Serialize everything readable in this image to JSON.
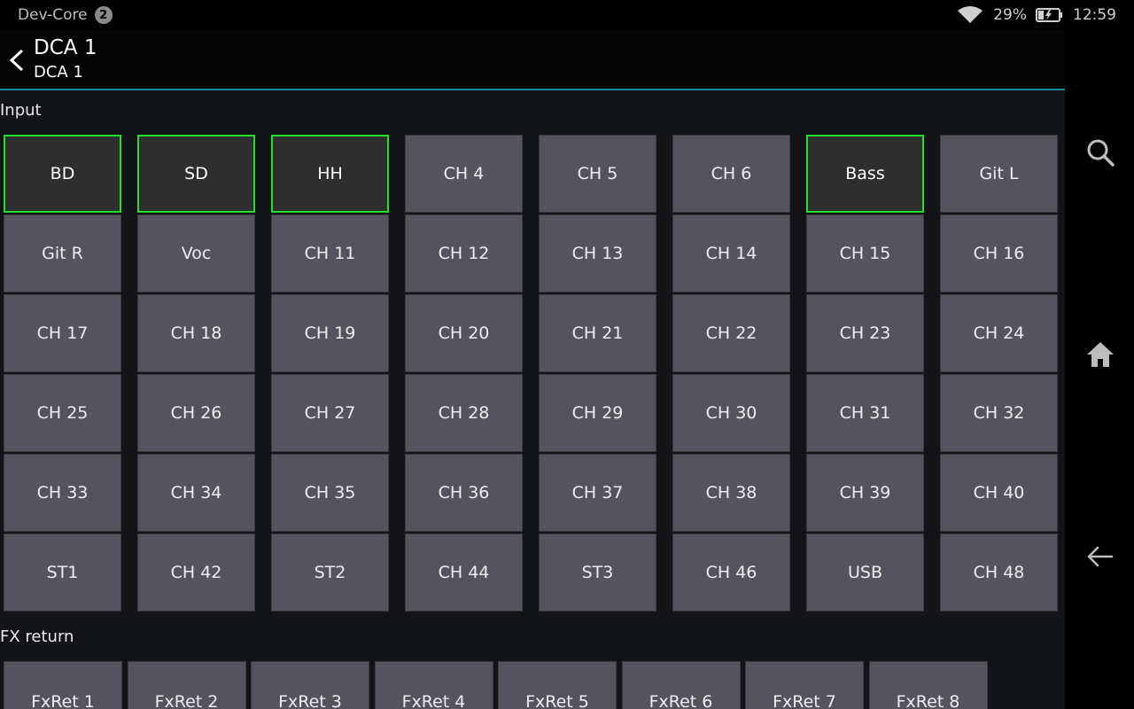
{
  "status_bar": {
    "app_name": "Dev-Core",
    "notification_count": "2",
    "battery": "29%",
    "time": "12:59"
  },
  "header": {
    "title": "DCA 1",
    "subtitle": "DCA 1"
  },
  "input": {
    "label": "Input",
    "active_color": "#22e02a",
    "channels": [
      {
        "label": "BD",
        "active": true
      },
      {
        "label": "SD",
        "active": true
      },
      {
        "label": "HH",
        "active": true
      },
      {
        "label": "CH 4",
        "active": false
      },
      {
        "label": "CH 5",
        "active": false
      },
      {
        "label": "CH 6",
        "active": false
      },
      {
        "label": "Bass",
        "active": true
      },
      {
        "label": "Git L",
        "active": false
      },
      {
        "label": "Git R",
        "active": false
      },
      {
        "label": "Voc",
        "active": false
      },
      {
        "label": "CH 11",
        "active": false
      },
      {
        "label": "CH 12",
        "active": false
      },
      {
        "label": "CH 13",
        "active": false
      },
      {
        "label": "CH 14",
        "active": false
      },
      {
        "label": "CH 15",
        "active": false
      },
      {
        "label": "CH 16",
        "active": false
      },
      {
        "label": "CH 17",
        "active": false
      },
      {
        "label": "CH 18",
        "active": false
      },
      {
        "label": "CH 19",
        "active": false
      },
      {
        "label": "CH 20",
        "active": false
      },
      {
        "label": "CH 21",
        "active": false
      },
      {
        "label": "CH 22",
        "active": false
      },
      {
        "label": "CH 23",
        "active": false
      },
      {
        "label": "CH 24",
        "active": false
      },
      {
        "label": "CH 25",
        "active": false
      },
      {
        "label": "CH 26",
        "active": false
      },
      {
        "label": "CH 27",
        "active": false
      },
      {
        "label": "CH 28",
        "active": false
      },
      {
        "label": "CH 29",
        "active": false
      },
      {
        "label": "CH 30",
        "active": false
      },
      {
        "label": "CH 31",
        "active": false
      },
      {
        "label": "CH 32",
        "active": false
      },
      {
        "label": "CH 33",
        "active": false
      },
      {
        "label": "CH 34",
        "active": false
      },
      {
        "label": "CH 35",
        "active": false
      },
      {
        "label": "CH 36",
        "active": false
      },
      {
        "label": "CH 37",
        "active": false
      },
      {
        "label": "CH 38",
        "active": false
      },
      {
        "label": "CH 39",
        "active": false
      },
      {
        "label": "CH 40",
        "active": false
      },
      {
        "label": "ST1",
        "active": false
      },
      {
        "label": "CH 42",
        "active": false
      },
      {
        "label": "ST2",
        "active": false
      },
      {
        "label": "CH 44",
        "active": false
      },
      {
        "label": "ST3",
        "active": false
      },
      {
        "label": "CH 46",
        "active": false
      },
      {
        "label": "USB",
        "active": false
      },
      {
        "label": "CH 48",
        "active": false
      }
    ]
  },
  "fx_return": {
    "label": "FX return",
    "items": [
      "FxRet 1",
      "FxRet 2",
      "FxRet 3",
      "FxRet 4",
      "FxRet 5",
      "FxRet 6",
      "FxRet 7",
      "FxRet 8"
    ]
  },
  "icons": {
    "back": "chevron-left-icon",
    "wifi": "wifi-icon",
    "battery": "battery-charging-icon",
    "search": "search-icon",
    "home": "home-icon",
    "nav_back": "arrow-left-icon"
  }
}
